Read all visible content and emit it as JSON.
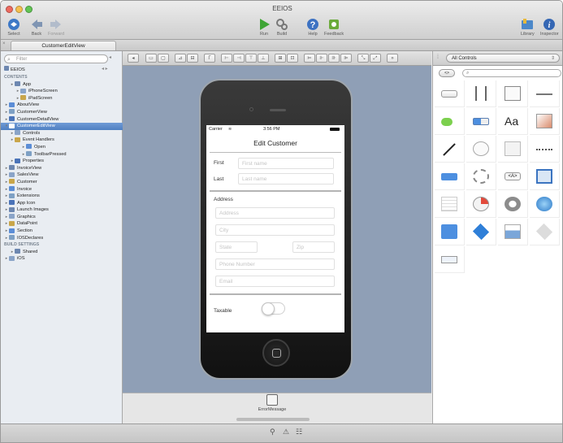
{
  "window": {
    "title": "EEIOS"
  },
  "toolbar": {
    "select_label": "Select",
    "back_label": "Back",
    "forward_label": "Forward",
    "run_label": "Run",
    "build_label": "Build",
    "help_label": "Help",
    "feedback_label": "Feedback",
    "library_label": "Library",
    "inspector_label": "Inspector"
  },
  "tab": {
    "label": "CustomerEditView"
  },
  "sidebar": {
    "filter_placeholder": "Filter",
    "project_label": "EEIOS",
    "items": [
      {
        "label": "CONTENTS",
        "type": "head"
      },
      {
        "label": "App",
        "indent": 1
      },
      {
        "label": "iPhoneScreen",
        "indent": 2
      },
      {
        "label": "iPadScreen",
        "indent": 2
      },
      {
        "label": "AboutView",
        "indent": 0
      },
      {
        "label": "CustomerView",
        "indent": 0
      },
      {
        "label": "CustomerDetailView",
        "indent": 0
      },
      {
        "label": "CustomerEditView",
        "indent": 0,
        "selected": true
      },
      {
        "label": "Controls",
        "indent": 1
      },
      {
        "label": "Event Handlers",
        "indent": 1
      },
      {
        "label": "Open",
        "indent": 3
      },
      {
        "label": "ToolbarPressed",
        "indent": 3
      },
      {
        "label": "Properties",
        "indent": 1
      },
      {
        "label": "InvoiceView",
        "indent": 0
      },
      {
        "label": "SalesView",
        "indent": 0
      },
      {
        "label": "Customer",
        "indent": 0
      },
      {
        "label": "Invoice",
        "indent": 0
      },
      {
        "label": "Extensions",
        "indent": 0
      },
      {
        "label": "App Icon",
        "indent": 0
      },
      {
        "label": "Launch Images",
        "indent": 0
      },
      {
        "label": "Graphics",
        "indent": 0
      },
      {
        "label": "DataPoint",
        "indent": 0
      },
      {
        "label": "Section",
        "indent": 0
      },
      {
        "label": "IOSDeclares",
        "indent": 0
      },
      {
        "label": "BUILD SETTINGS",
        "type": "head"
      },
      {
        "label": "Shared",
        "indent": 1
      },
      {
        "label": "iOS",
        "indent": 0
      }
    ]
  },
  "library": {
    "filter_label": "All Controls",
    "seg_label": "<>"
  },
  "phone": {
    "carrier": "Carrier",
    "time": "3:56 PM",
    "nav_title": "Edit Customer",
    "first_label": "First",
    "first_placeholder": "First name",
    "last_label": "Last",
    "last_placeholder": "Last name",
    "address_heading": "Address",
    "address_placeholder": "Address",
    "city_placeholder": "City",
    "state_placeholder": "State",
    "zip_placeholder": "Zip",
    "phone_placeholder": "Phone Number",
    "email_placeholder": "Email",
    "taxable_label": "Taxable"
  },
  "canvas": {
    "system_item_label": "ErrorMessage"
  }
}
